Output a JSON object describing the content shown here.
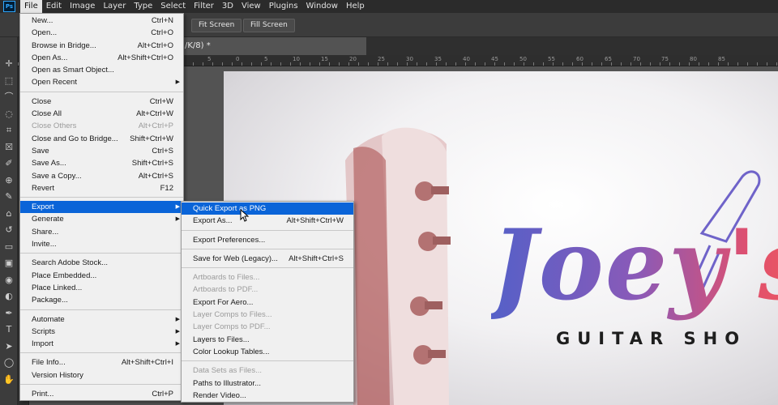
{
  "menubar": {
    "logo": "Ps",
    "items": [
      "File",
      "Edit",
      "Image",
      "Layer",
      "Type",
      "Select",
      "Filter",
      "3D",
      "View",
      "Plugins",
      "Window",
      "Help"
    ],
    "active_index": 0
  },
  "options_bar": {
    "buttons": [
      "Fit Screen",
      "Fill Screen"
    ]
  },
  "document_tab": {
    "title": "/K/8) *"
  },
  "ruler": {
    "labels": [
      "5",
      "0",
      "5",
      "10",
      "15",
      "20",
      "25",
      "30",
      "35",
      "40",
      "45",
      "50",
      "55",
      "60",
      "65",
      "70",
      "75",
      "80",
      "85"
    ]
  },
  "canvas": {
    "logo_script": "Joey's",
    "logo_subtitle": "GUITAR SHO",
    "colors": {
      "gradient_start": "#5560c8",
      "gradient_end": "#f05a5a",
      "subtitle": "#1e1e1e"
    }
  },
  "file_menu": {
    "groups": [
      [
        {
          "label": "New...",
          "shortcut": "Ctrl+N"
        },
        {
          "label": "Open...",
          "shortcut": "Ctrl+O"
        },
        {
          "label": "Browse in Bridge...",
          "shortcut": "Alt+Ctrl+O"
        },
        {
          "label": "Open As...",
          "shortcut": "Alt+Shift+Ctrl+O"
        },
        {
          "label": "Open as Smart Object...",
          "shortcut": ""
        },
        {
          "label": "Open Recent",
          "shortcut": "",
          "submenu": true
        }
      ],
      [
        {
          "label": "Close",
          "shortcut": "Ctrl+W"
        },
        {
          "label": "Close All",
          "shortcut": "Alt+Ctrl+W"
        },
        {
          "label": "Close Others",
          "shortcut": "Alt+Ctrl+P",
          "disabled": true
        },
        {
          "label": "Close and Go to Bridge...",
          "shortcut": "Shift+Ctrl+W"
        },
        {
          "label": "Save",
          "shortcut": "Ctrl+S"
        },
        {
          "label": "Save As...",
          "shortcut": "Shift+Ctrl+S"
        },
        {
          "label": "Save a Copy...",
          "shortcut": "Alt+Ctrl+S"
        },
        {
          "label": "Revert",
          "shortcut": "F12"
        }
      ],
      [
        {
          "label": "Export",
          "shortcut": "",
          "submenu": true,
          "highlighted": true
        },
        {
          "label": "Generate",
          "shortcut": "",
          "submenu": true
        },
        {
          "label": "Share...",
          "shortcut": ""
        },
        {
          "label": "Invite...",
          "shortcut": ""
        }
      ],
      [
        {
          "label": "Search Adobe Stock...",
          "shortcut": ""
        },
        {
          "label": "Place Embedded...",
          "shortcut": ""
        },
        {
          "label": "Place Linked...",
          "shortcut": ""
        },
        {
          "label": "Package...",
          "shortcut": ""
        }
      ],
      [
        {
          "label": "Automate",
          "shortcut": "",
          "submenu": true
        },
        {
          "label": "Scripts",
          "shortcut": "",
          "submenu": true
        },
        {
          "label": "Import",
          "shortcut": "",
          "submenu": true
        }
      ],
      [
        {
          "label": "File Info...",
          "shortcut": "Alt+Shift+Ctrl+I"
        },
        {
          "label": "Version History",
          "shortcut": ""
        }
      ],
      [
        {
          "label": "Print...",
          "shortcut": "Ctrl+P"
        }
      ]
    ]
  },
  "export_menu": {
    "groups": [
      [
        {
          "label": "Quick Export as PNG",
          "shortcut": "",
          "highlighted": true
        },
        {
          "label": "Export As...",
          "shortcut": "Alt+Shift+Ctrl+W"
        }
      ],
      [
        {
          "label": "Export Preferences...",
          "shortcut": ""
        }
      ],
      [
        {
          "label": "Save for Web (Legacy)...",
          "shortcut": "Alt+Shift+Ctrl+S"
        }
      ],
      [
        {
          "label": "Artboards to Files...",
          "shortcut": "",
          "disabled": true
        },
        {
          "label": "Artboards to PDF...",
          "shortcut": "",
          "disabled": true
        },
        {
          "label": "Export For Aero...",
          "shortcut": ""
        },
        {
          "label": "Layer Comps to Files...",
          "shortcut": "",
          "disabled": true
        },
        {
          "label": "Layer Comps to PDF...",
          "shortcut": "",
          "disabled": true
        },
        {
          "label": "Layers to Files...",
          "shortcut": ""
        },
        {
          "label": "Color Lookup Tables...",
          "shortcut": ""
        }
      ],
      [
        {
          "label": "Data Sets as Files...",
          "shortcut": "",
          "disabled": true
        },
        {
          "label": "Paths to Illustrator...",
          "shortcut": ""
        },
        {
          "label": "Render Video...",
          "shortcut": ""
        }
      ]
    ]
  },
  "toolbar": {
    "tools": [
      "move-tool-icon",
      "marquee-tool-icon",
      "lasso-tool-icon",
      "quick-select-tool-icon",
      "crop-tool-icon",
      "frame-tool-icon",
      "eyedropper-tool-icon",
      "healing-brush-tool-icon",
      "brush-tool-icon",
      "clone-stamp-tool-icon",
      "history-brush-tool-icon",
      "eraser-tool-icon",
      "gradient-tool-icon",
      "blur-tool-icon",
      "dodge-tool-icon",
      "pen-tool-icon",
      "type-tool-icon",
      "path-select-tool-icon",
      "shape-tool-icon",
      "hand-tool-icon"
    ]
  }
}
